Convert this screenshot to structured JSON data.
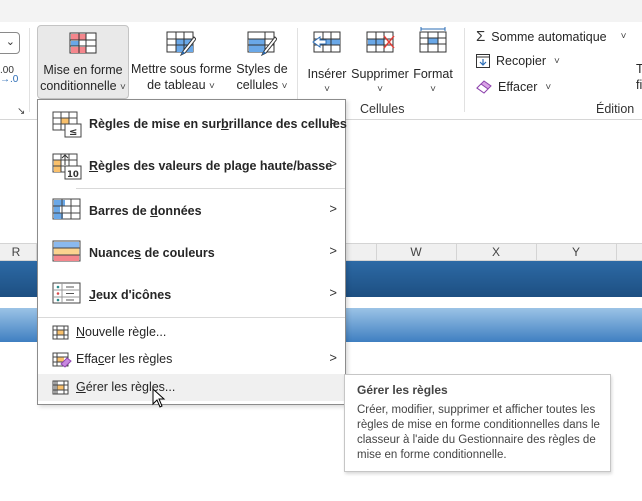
{
  "ribbon": {
    "styles_group": {
      "conditional_formatting": {
        "line1": "Mise en forme",
        "line2": "conditionnelle",
        "chevron": "˅"
      },
      "format_as_table": {
        "line1": "Mettre sous forme",
        "line2": "de tableau",
        "chevron": "˅"
      },
      "cell_styles": {
        "line1": "Styles de",
        "line2": "cellules",
        "chevron": "˅"
      }
    },
    "number_group": {
      "decrease_decimal_top": ".00",
      "decrease_decimal_bottom": "→.0",
      "launcher": "↘"
    },
    "cells_group": {
      "label": "Cellules",
      "insert": {
        "label": "Insérer",
        "chevron": "˅"
      },
      "delete": {
        "label": "Supprimer",
        "chevron": "˅"
      },
      "format": {
        "label": "Format",
        "chevron": "˅"
      }
    },
    "editing_group": {
      "label": "Édition",
      "autosum": {
        "label": "Somme automatique",
        "chevron": "˅",
        "icon": "Σ"
      },
      "fill": {
        "label": "Recopier",
        "chevron": "˅"
      },
      "clear": {
        "label": "Effacer",
        "chevron": "˅"
      },
      "cutoff_line1": "T",
      "cutoff_line2": "fi"
    }
  },
  "sheet": {
    "columns": [
      "R",
      "W",
      "X",
      "Y"
    ],
    "band_dark_color": "#1f5590",
    "band_light_color": "#6ea3d6"
  },
  "menu": {
    "items": [
      {
        "pre": "Règles de mise en sur",
        "u": "b",
        "post": "rillance des cellules",
        "submenu": ">"
      },
      {
        "pre": "",
        "u": "R",
        "post": "ègles des valeurs de plage haute/basse",
        "submenu": ">"
      },
      {
        "pre": "Barres de ",
        "u": "d",
        "post": "onnées",
        "submenu": ">"
      },
      {
        "pre": "Nuance",
        "u": "s",
        "post": " de couleurs",
        "submenu": ">"
      },
      {
        "pre": "",
        "u": "J",
        "post": "eux d'icônes",
        "submenu": ">"
      },
      {
        "pre": "",
        "u": "N",
        "post": "ouvelle règle...",
        "submenu": ""
      },
      {
        "pre": "Effa",
        "u": "c",
        "post": "er les règles",
        "submenu": ">"
      },
      {
        "pre": "",
        "u": "G",
        "post": "érer les règles...",
        "submenu": ""
      }
    ]
  },
  "tooltip": {
    "title": "Gérer les règles",
    "body": "Créer, modifier, supprimer et afficher toutes les règles de mise en forme conditionnelles dans le classeur à l'aide du Gestionnaire des règles de mise en forme conditionnelle."
  },
  "colors": {
    "accent_blue": "#2b6cb5",
    "highlight_red": "#f4868c",
    "highlight_orange": "#f9c06b"
  }
}
